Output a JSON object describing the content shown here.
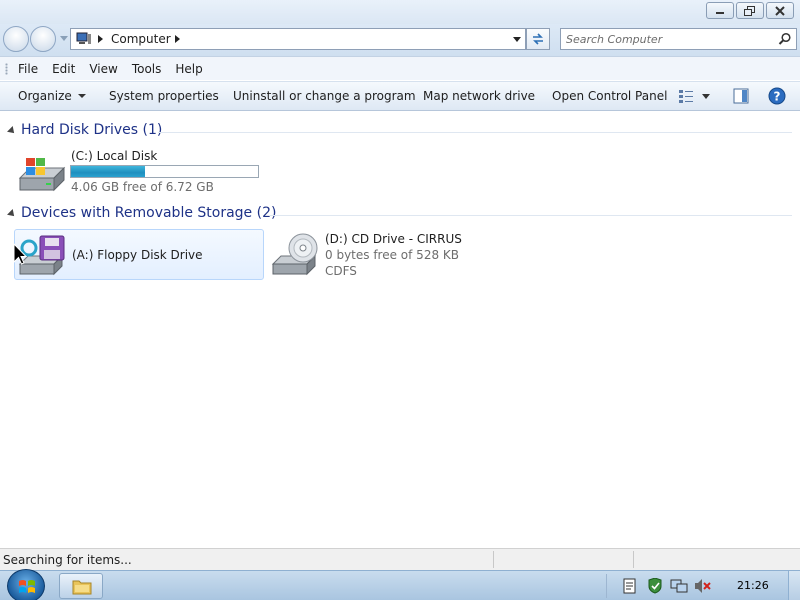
{
  "window": {
    "caption_buttons": [
      "minimize",
      "maximize",
      "close"
    ]
  },
  "address": {
    "crumb": "Computer",
    "search_placeholder": "Search Computer"
  },
  "menu": {
    "items": [
      "File",
      "Edit",
      "View",
      "Tools",
      "Help"
    ]
  },
  "commands": {
    "organize": "Organize",
    "system_properties": "System properties",
    "uninstall": "Uninstall or change a program",
    "map_network": "Map network drive",
    "open_control_panel": "Open Control Panel"
  },
  "groups": [
    {
      "title": "Hard Disk Drives (1)",
      "items": [
        {
          "name": "(C:) Local Disk",
          "free_text": "4.06 GB free of 6.72 GB",
          "used_fraction": 0.396,
          "icon": "hard-disk-icon"
        }
      ]
    },
    {
      "title": "Devices with Removable Storage (2)",
      "items": [
        {
          "name": "(A:) Floppy Disk Drive",
          "icon": "floppy-drive-icon",
          "selected": true
        },
        {
          "name": "(D:) CD Drive - CIRRUS",
          "detail1": "0 bytes free of 528 KB",
          "detail2": "CDFS",
          "icon": "cd-drive-icon"
        }
      ]
    }
  ],
  "status": {
    "text": "Searching for items..."
  },
  "taskbar": {
    "clock": "21:26",
    "tray_icons": [
      "action-center-icon",
      "security-shield-icon",
      "network-icon",
      "volume-muted-icon"
    ]
  },
  "colors": {
    "group_title": "#1e3287",
    "capacity_fill": "#26a0da",
    "selection": "#e3efff"
  }
}
